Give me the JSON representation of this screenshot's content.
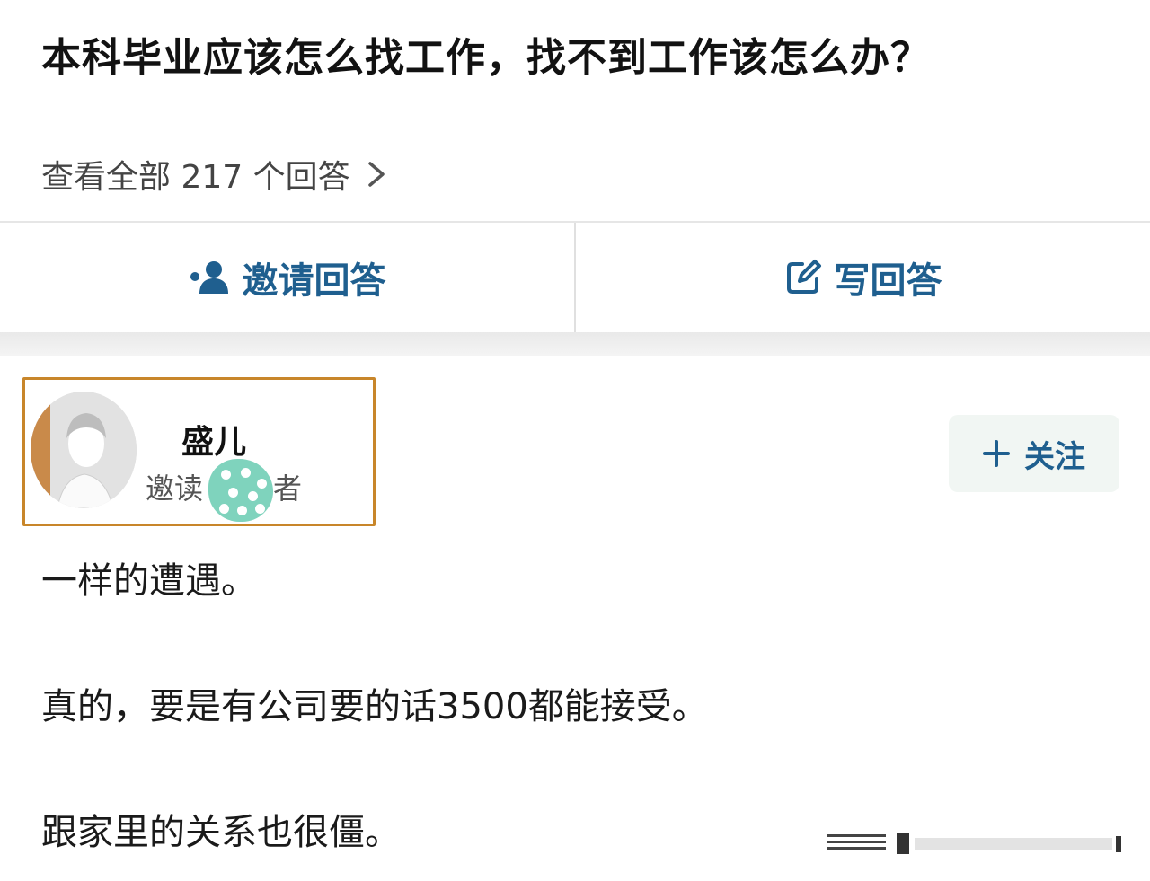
{
  "question": {
    "title": "本科毕业应该怎么找工作，找不到工作该怎么办？",
    "view_all": "查看全部 217 个回答"
  },
  "actions": {
    "invite": "邀请回答",
    "write": "写回答"
  },
  "author": {
    "name": "盛儿",
    "subtitle_left": "邀读",
    "subtitle_right": "者"
  },
  "follow": {
    "label": "关注"
  },
  "content": {
    "paragraphs": [
      "一样的遭遇。",
      "真的，要是有公司要的话3500都能接受。",
      "跟家里的关系也很僵。"
    ]
  },
  "colors": {
    "accent": "#1f5f8f",
    "highlight_border": "#c8862a",
    "blur_blob": "#7fd3bd"
  },
  "icons": {
    "chevron": "chevron-right-icon",
    "invite": "person-add-icon",
    "write": "edit-icon",
    "follow": "plus-icon"
  }
}
